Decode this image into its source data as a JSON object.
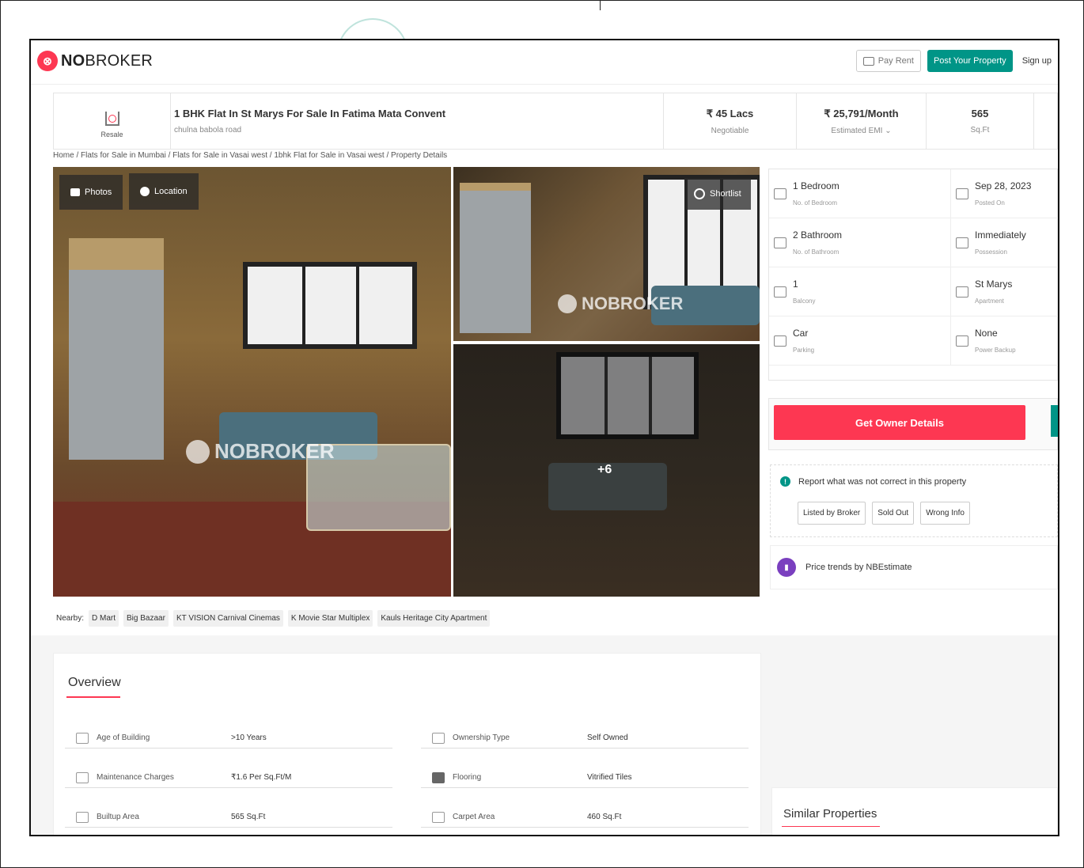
{
  "header": {
    "logo_mark": "⊗",
    "logo_bold": "NO",
    "logo_rest": "BROKER",
    "pay_rent": "Pay Rent",
    "post_property": "Post Your Property",
    "sign_up": "Sign up"
  },
  "listing": {
    "type_label": "Resale",
    "title": "1 BHK Flat In St Marys For Sale In Fatima Mata Convent",
    "subtitle": "chulna babola road",
    "price": "₹ 45 Lacs",
    "price_note": "Negotiable",
    "emi": "₹ 25,791/Month",
    "emi_note": "Estimated EMI ⌄",
    "area": "565",
    "area_unit": "Sq.Ft"
  },
  "breadcrumb": "Home / Flats for Sale in Mumbai / Flats for Sale in Vasai west / 1bhk Flat for Sale in Vasai west / Property Details",
  "gallery": {
    "photos_btn": "Photos",
    "location_btn": "Location",
    "shortlist_btn": "Shortlist",
    "watermark": "NOBROKER",
    "more_count": "+6"
  },
  "nearby": {
    "label": "Nearby:",
    "items": [
      "D Mart",
      "Big Bazaar",
      "KT VISION Carnival Cinemas",
      "K Movie Star Multiplex",
      "Kauls Heritage City Apartment"
    ]
  },
  "facts": [
    {
      "value": "1 Bedroom",
      "label": "No. of Bedroom"
    },
    {
      "value": "Sep 28, 2023",
      "label": "Posted On"
    },
    {
      "value": "2 Bathroom",
      "label": "No. of Bathroom"
    },
    {
      "value": "Immediately",
      "label": "Possession"
    },
    {
      "value": "1",
      "label": "Balcony"
    },
    {
      "value": "St Marys",
      "label": "Apartment"
    },
    {
      "value": "Car",
      "label": "Parking"
    },
    {
      "value": "None",
      "label": "Power Backup"
    }
  ],
  "owner": {
    "button": "Get Owner Details"
  },
  "report": {
    "text": "Report what was not correct in this property",
    "buttons": [
      "Listed by Broker",
      "Sold Out",
      "Wrong Info"
    ]
  },
  "trends": {
    "text": "Price trends by NBEstimate"
  },
  "overview": {
    "title": "Overview",
    "rows": [
      {
        "label": "Age of Building",
        "value": ">10 Years"
      },
      {
        "label": "Ownership Type",
        "value": "Self Owned"
      },
      {
        "label": "Maintenance Charges",
        "value": "₹1.6 Per Sq.Ft/M"
      },
      {
        "label": "Flooring",
        "value": "Vitrified Tiles"
      },
      {
        "label": "Builtup Area",
        "value": "565 Sq.Ft"
      },
      {
        "label": "Carpet Area",
        "value": "460 Sq.Ft"
      }
    ]
  },
  "similar": {
    "title": "Similar Properties"
  },
  "colors": {
    "brand_red": "#fd3752",
    "brand_teal": "#009587",
    "trend_purple": "#7a3fbf"
  }
}
